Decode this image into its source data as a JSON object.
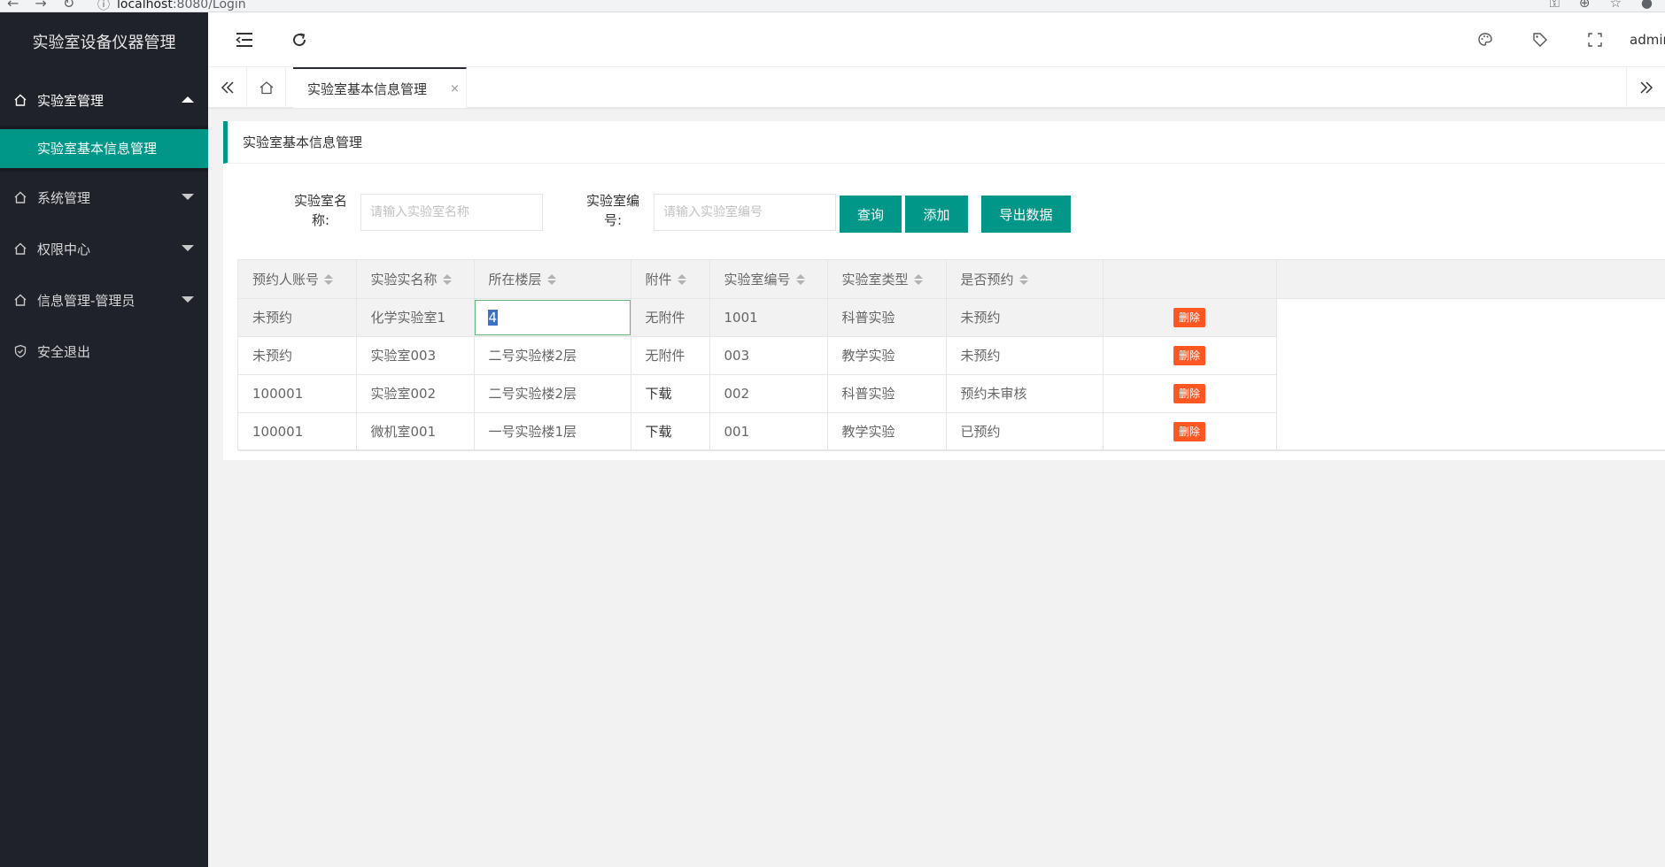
{
  "browser": {
    "url_host": "localhost",
    "url_path": ":8080/Login"
  },
  "app": {
    "title": "实验室设备仪器管理",
    "user": "admin"
  },
  "sidebar": {
    "items": [
      {
        "label": "实验室管理",
        "icon": "home-icon",
        "state": "open"
      },
      {
        "label": "系统管理",
        "icon": "home-icon",
        "state": "collapsed"
      },
      {
        "label": "权限中心",
        "icon": "home-icon",
        "state": "collapsed"
      },
      {
        "label": "信息管理-管理员",
        "icon": "home-icon",
        "state": "collapsed"
      },
      {
        "label": "安全退出",
        "icon": "shield-check-icon"
      }
    ],
    "submenu": [
      {
        "label": "实验室基本信息管理",
        "active": true
      }
    ]
  },
  "header": {
    "icons": [
      "menu-fold-icon",
      "refresh-icon",
      "theme-palette-icon",
      "tag-icon",
      "fullscreen-icon"
    ]
  },
  "tabs": {
    "active_label": "实验室基本信息管理",
    "close_glyph": "×"
  },
  "card": {
    "title": "实验室基本信息管理"
  },
  "search": {
    "name_label": "实验室名称:",
    "name_placeholder": "请输入实验室名称",
    "code_label": "实验室编号:",
    "code_placeholder": "请输入实验室编号",
    "query_btn": "查询",
    "add_btn": "添加",
    "export_btn": "导出数据"
  },
  "table": {
    "columns": [
      "预约人账号",
      "实验实名称",
      "所在楼层",
      "附件",
      "实验室编号",
      "实验室类型",
      "是否预约"
    ],
    "delete_label": "删除",
    "rows": [
      [
        "未预约",
        "化学实验室1",
        "4",
        "无附件",
        "1001",
        "科普实验",
        "未预约"
      ],
      [
        "未预约",
        "实验室003",
        "二号实验楼2层",
        "无附件",
        "003",
        "教学实验",
        "未预约"
      ],
      [
        "100001",
        "实验室002",
        "二号实验楼2层",
        "下载",
        "002",
        "科普实验",
        "预约未审核"
      ],
      [
        "100001",
        "微机室001",
        "一号实验楼1层",
        "下载",
        "001",
        "教学实验",
        "已预约"
      ]
    ]
  },
  "colors": {
    "accent": "#009688",
    "sidebar_bg": "#20222a",
    "danger": "#ff5722"
  }
}
